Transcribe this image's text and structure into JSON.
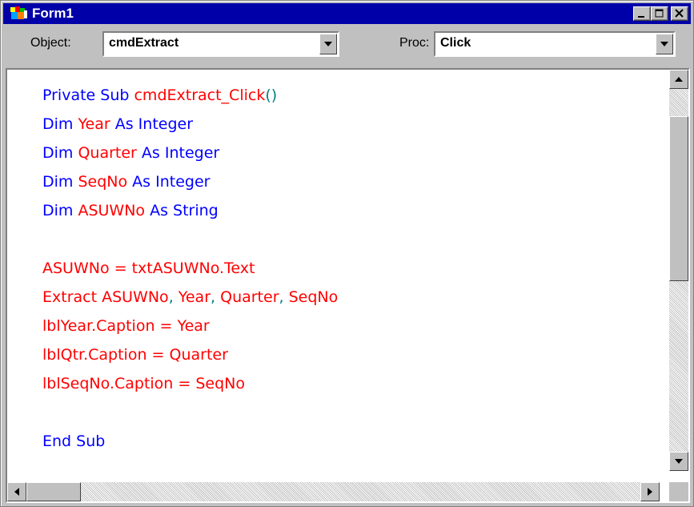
{
  "window": {
    "title": "Form1",
    "icon": "vb-form-icon",
    "controls": [
      "minimize",
      "maximize",
      "close"
    ]
  },
  "toolbar": {
    "object_label": "Object:",
    "object_value": "cmdExtract",
    "proc_label": "Proc:",
    "proc_value": "Click"
  },
  "code": {
    "lines": [
      [
        {
          "t": "Private Sub ",
          "c": "kw"
        },
        {
          "t": "cmdExtract_Click",
          "c": "id"
        },
        {
          "t": "()",
          "c": "pu"
        }
      ],
      [
        {
          "t": "Dim ",
          "c": "kw"
        },
        {
          "t": "Year",
          "c": "id"
        },
        {
          "t": " As Integer",
          "c": "kw"
        }
      ],
      [
        {
          "t": "Dim ",
          "c": "kw"
        },
        {
          "t": "Quarter",
          "c": "id"
        },
        {
          "t": " As Integer",
          "c": "kw"
        }
      ],
      [
        {
          "t": "Dim ",
          "c": "kw"
        },
        {
          "t": "SeqNo",
          "c": "id"
        },
        {
          "t": " As Integer",
          "c": "kw"
        }
      ],
      [
        {
          "t": "Dim ",
          "c": "kw"
        },
        {
          "t": "ASUWNo",
          "c": "id"
        },
        {
          "t": " As String",
          "c": "kw"
        }
      ],
      [],
      [
        {
          "t": "ASUWNo = txtASUWNo.Text",
          "c": "id"
        }
      ],
      [
        {
          "t": "Extract ASUWNo",
          "c": "id"
        },
        {
          "t": ", ",
          "c": "pu"
        },
        {
          "t": "Year",
          "c": "id"
        },
        {
          "t": ", ",
          "c": "pu"
        },
        {
          "t": "Quarter",
          "c": "id"
        },
        {
          "t": ", ",
          "c": "pu"
        },
        {
          "t": "SeqNo",
          "c": "id"
        }
      ],
      [
        {
          "t": "lblYear.Caption = Year",
          "c": "id"
        }
      ],
      [
        {
          "t": "lblQtr.Caption = Quarter",
          "c": "id"
        }
      ],
      [
        {
          "t": "lblSeqNo.Caption = SeqNo",
          "c": "id"
        }
      ],
      [],
      [
        {
          "t": "End Sub",
          "c": "kw"
        }
      ]
    ]
  },
  "colors": {
    "keyword": "#0000ff",
    "identifier": "#ff0000",
    "punctuation": "#008080",
    "titlebar": "#0000a8",
    "chrome": "#c0c0c0"
  }
}
